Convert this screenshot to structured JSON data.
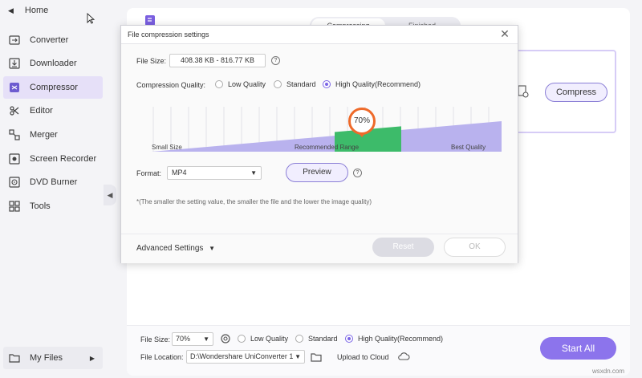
{
  "sidebar": {
    "home_label": "Home",
    "items": [
      {
        "label": "Converter",
        "icon": "converter-icon"
      },
      {
        "label": "Downloader",
        "icon": "downloader-icon"
      },
      {
        "label": "Compressor",
        "icon": "compressor-icon",
        "active": true
      },
      {
        "label": "Editor",
        "icon": "editor-icon"
      },
      {
        "label": "Merger",
        "icon": "merger-icon"
      },
      {
        "label": "Screen Recorder",
        "icon": "screen-recorder-icon"
      },
      {
        "label": "DVD Burner",
        "icon": "dvd-burner-icon"
      },
      {
        "label": "Tools",
        "icon": "tools-icon"
      }
    ],
    "my_files_label": "My Files"
  },
  "main": {
    "tabs": [
      {
        "label": "Compressing",
        "selected": true
      },
      {
        "label": "Finished",
        "selected": false
      }
    ],
    "compress_button": "Compress"
  },
  "dialog": {
    "title": "File compression settings",
    "file_size_label": "File Size:",
    "file_size_value": "408.38 KB - 816.77 KB",
    "quality_label": "Compression Quality:",
    "quality_options": [
      {
        "label": "Low Quality",
        "selected": false
      },
      {
        "label": "Standard",
        "selected": false
      },
      {
        "label": "High Quality(Recommend)",
        "selected": true
      }
    ],
    "slider": {
      "percent_label": "70%",
      "value": 70,
      "small_size_label": "Small Size",
      "recommended_label": "Recommended Range",
      "best_quality_label": "Best Quality"
    },
    "format_label": "Format:",
    "format_value": "MP4",
    "preview_button": "Preview",
    "note": "*(The smaller the setting value, the smaller the file and the lower the image quality)",
    "advanced_label": "Advanced Settings",
    "reset_button": "Reset",
    "ok_button": "OK"
  },
  "bottom": {
    "file_size_label": "File Size:",
    "file_size_value": "70%",
    "quality_options": [
      {
        "label": "Low Quality",
        "selected": false
      },
      {
        "label": "Standard",
        "selected": false
      },
      {
        "label": "High Quality(Recommend)",
        "selected": true
      }
    ],
    "file_location_label": "File Location:",
    "file_location_value": "D:\\Wondershare UniConverter 1",
    "upload_label": "Upload to Cloud",
    "start_all_button": "Start All"
  },
  "watermark": "wsxdn.com",
  "colors": {
    "accent": "#8c74ec",
    "recommended": "#3dbb6a",
    "slider_fill": "#b9b2ee",
    "pin": "#ee6a2a"
  }
}
